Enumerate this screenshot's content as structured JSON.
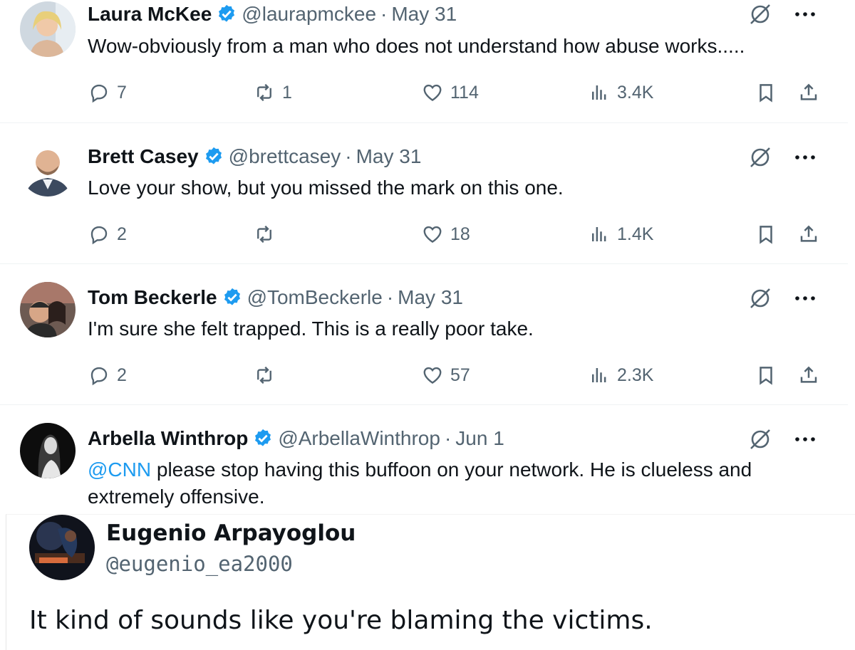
{
  "colors": {
    "text": "#0f1419",
    "muted": "#536471",
    "accent": "#1d9bf0",
    "verified": "#1d9bf0"
  },
  "replies": [
    {
      "name": "Laura McKee",
      "handle": "@laurapmckee",
      "separator": "·",
      "date": "May 31",
      "mention": "",
      "text": "Wow-obviously from a man who does not understand how abuse works.....",
      "stats": {
        "replies": "7",
        "reposts": "1",
        "likes": "114",
        "views": "3.4K"
      }
    },
    {
      "name": "Brett Casey",
      "handle": "@brettcasey",
      "separator": "·",
      "date": "May 31",
      "mention": "",
      "text": "Love your show, but you missed the mark on this one.",
      "stats": {
        "replies": "2",
        "reposts": "",
        "likes": "18",
        "views": "1.4K"
      }
    },
    {
      "name": "Tom Beckerle",
      "handle": "@TomBeckerle",
      "separator": "·",
      "date": "May 31",
      "mention": "",
      "text": "I'm sure she felt trapped. This is a really poor take.",
      "stats": {
        "replies": "2",
        "reposts": "",
        "likes": "57",
        "views": "2.3K"
      }
    },
    {
      "name": "Arbella Winthrop",
      "handle": "@ArbellaWinthrop",
      "separator": "·",
      "date": "Jun 1",
      "mention": "@CNN",
      "text": "please stop having this buffoon on your network. He is clueless and extremely offensive."
    }
  ],
  "quote": {
    "name": "Eugenio Arpayoglou",
    "handle": "@eugenio_ea2000",
    "text": "It kind of sounds like you're blaming the victims."
  },
  "icons": [
    "verified-badge-icon",
    "grok-icon",
    "more-icon",
    "reply-icon",
    "repost-icon",
    "like-icon",
    "views-icon",
    "bookmark-icon",
    "share-icon"
  ]
}
